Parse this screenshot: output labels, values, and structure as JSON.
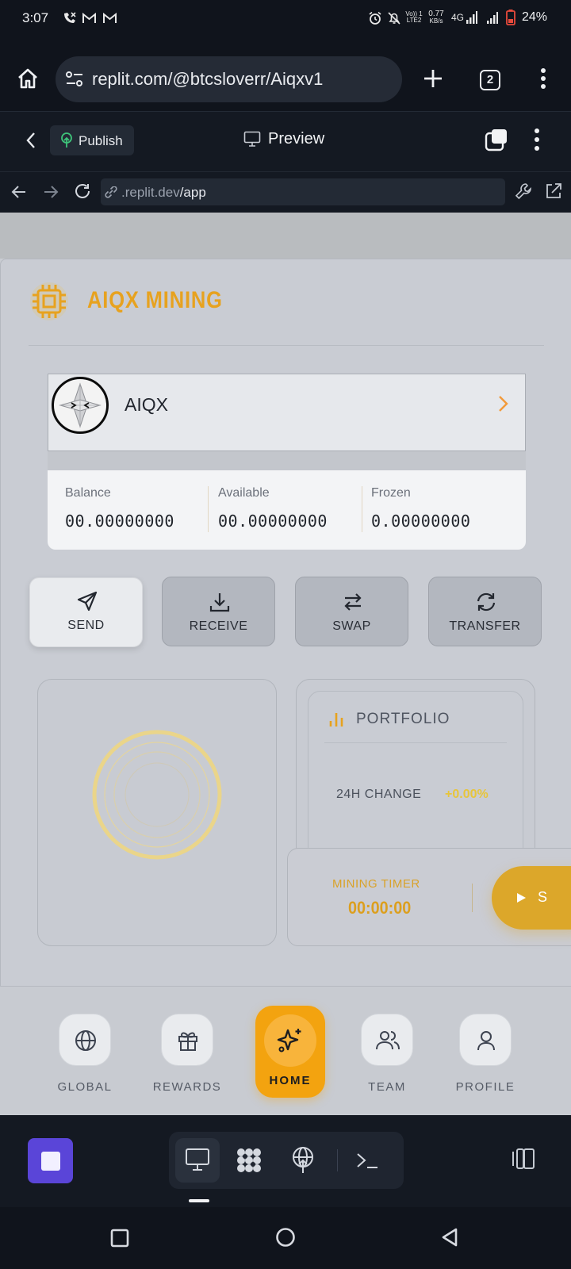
{
  "status_bar": {
    "time": "3:07",
    "battery": "24%",
    "network": "4G",
    "speed": "0.77",
    "speed_unit": "KB/s",
    "volte": "Vo)) 1",
    "lte": "LTE2"
  },
  "browser": {
    "url": "replit.com/@btcsloverr/Aiqxv1",
    "tab_count": "2"
  },
  "replit": {
    "publish_label": "Publish",
    "preview_title": "Preview",
    "preview_url_host": ".replit.dev",
    "preview_url_path": "/app"
  },
  "app": {
    "brand": "AIQX MINING",
    "asset": {
      "name": "AIQX"
    },
    "balances": [
      {
        "label": "Balance",
        "value": "00.00000000"
      },
      {
        "label": "Available",
        "value": "00.00000000"
      },
      {
        "label": "Frozen",
        "value": "0.00000000"
      }
    ],
    "actions": {
      "send": "SEND",
      "receive": "RECEIVE",
      "swap": "SWAP",
      "transfer": "TRANSFER"
    },
    "portfolio": {
      "title": "PORTFOLIO",
      "change_label": "24H CHANGE",
      "change_value": "+0.00%"
    },
    "timer": {
      "label": "MINING TIMER",
      "value": "00:00:00",
      "start_label": "S"
    },
    "nav": {
      "global": "GLOBAL",
      "rewards": "REWARDS",
      "home": "HOME",
      "team": "TEAM",
      "profile": "PROFILE"
    }
  },
  "colors": {
    "accent_gold": "#e7a21f",
    "home_orange": "#f3a30f",
    "stop_purple": "#5a45d8",
    "change_yellow": "#e7c53b"
  }
}
